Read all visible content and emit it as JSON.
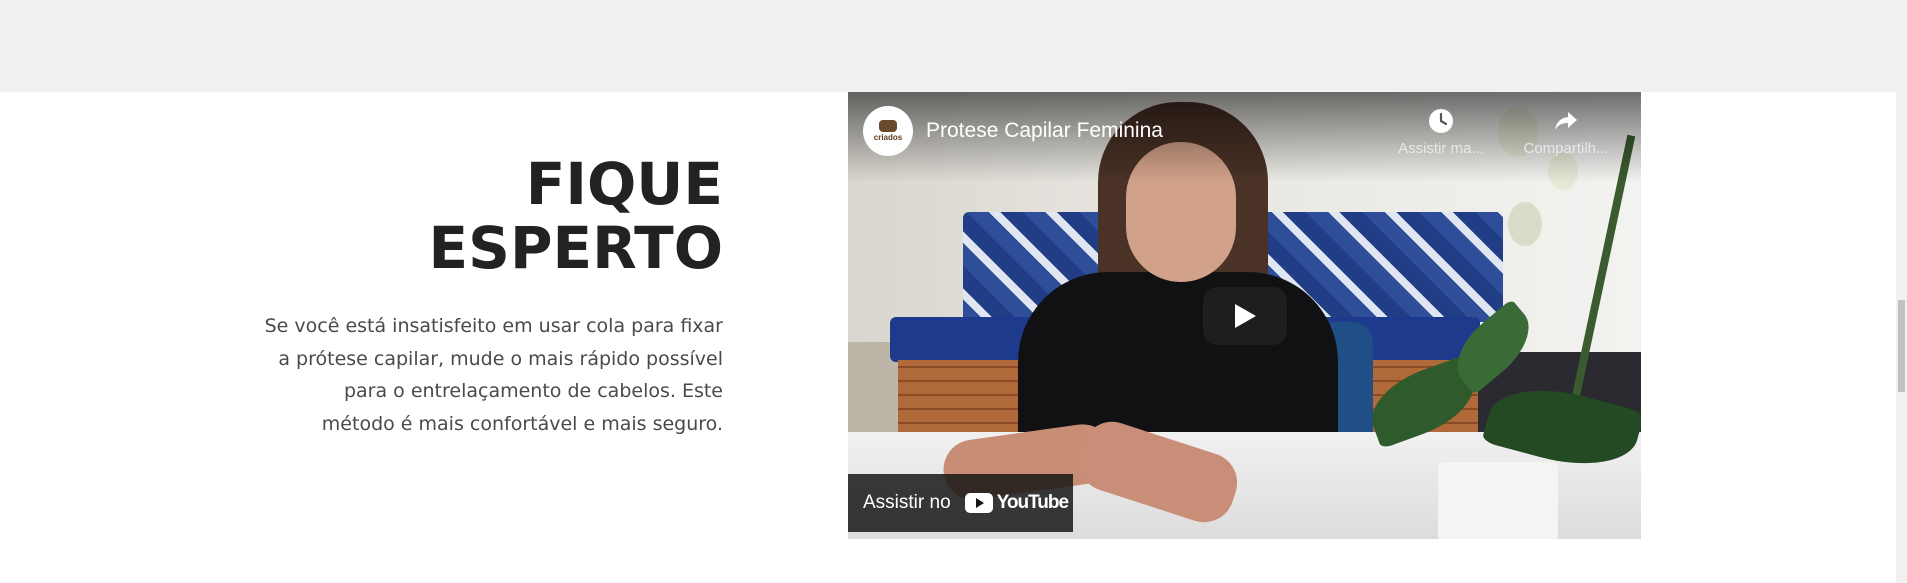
{
  "section": {
    "heading_line1": "FIQUE",
    "heading_line2": "ESPERTO",
    "body_lines": [
      "Se você está insatisfeito em usar cola para fixar",
      "a prótese capilar, mude o mais rápido possível",
      "para o entrelaçamento de cabelos. Este",
      "método é mais confortável e mais seguro."
    ]
  },
  "video": {
    "title": "Protese Capilar Feminina",
    "channel_avatar_text": "criados",
    "watch_later_label": "Assistir ma...",
    "share_label": "Compartilh...",
    "watch_on_label": "Assistir no",
    "youtube_wordmark": "YouTube",
    "play_icon": "play-icon",
    "watch_later_icon": "clock-icon",
    "share_icon": "share-arrow-icon"
  },
  "colors": {
    "heading": "#222222",
    "body_text": "#4a4a4a",
    "top_band": "#f1f1f1",
    "yt_red": "#ff0000"
  }
}
